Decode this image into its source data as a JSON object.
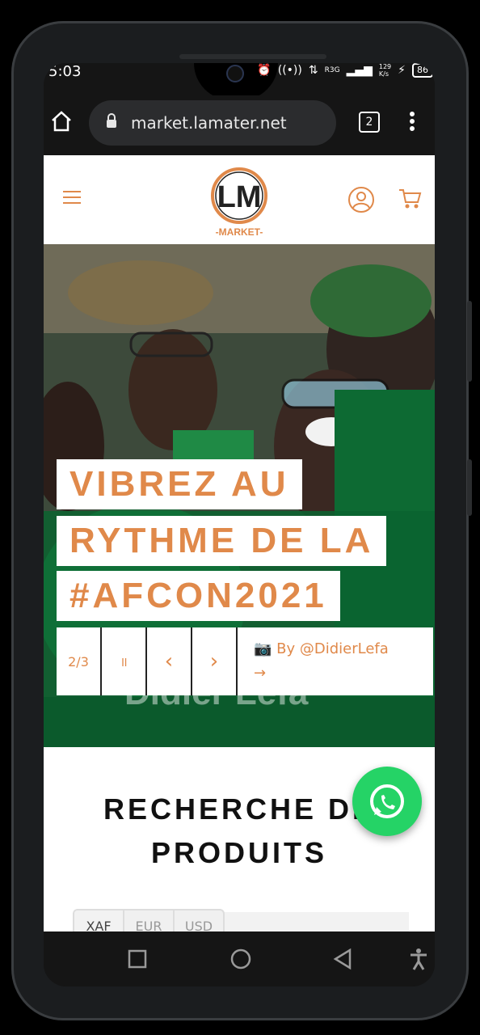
{
  "status_bar": {
    "time": "5:03",
    "network": "R3G",
    "speed_top": "129",
    "speed_bottom": "K/s",
    "battery": "86"
  },
  "browser": {
    "url": "market.lamater.net",
    "tab_count": "2"
  },
  "site": {
    "logo_text": "-MARKET-",
    "logo_letters": "LM"
  },
  "hero": {
    "headline_lines": [
      "VIBREZ AU",
      "RYTHME DE LA",
      "#AFCON2021"
    ],
    "slide_counter": "2/3",
    "pause_symbol": "॥",
    "prev_symbol": "‹",
    "next_symbol": "›",
    "credit_text": "📷 By @DidierLefa",
    "credit_arrow": "→",
    "watermark": "Didier Lefa"
  },
  "search": {
    "title_line1": "RECHERCHE DE",
    "title_line2": "PRODUITS",
    "currencies": [
      "XAF",
      "EUR",
      "USD"
    ],
    "active_currency": "XAF"
  },
  "colors": {
    "accent": "#e0894a",
    "whatsapp": "#25d366",
    "system_bg": "#151515"
  }
}
